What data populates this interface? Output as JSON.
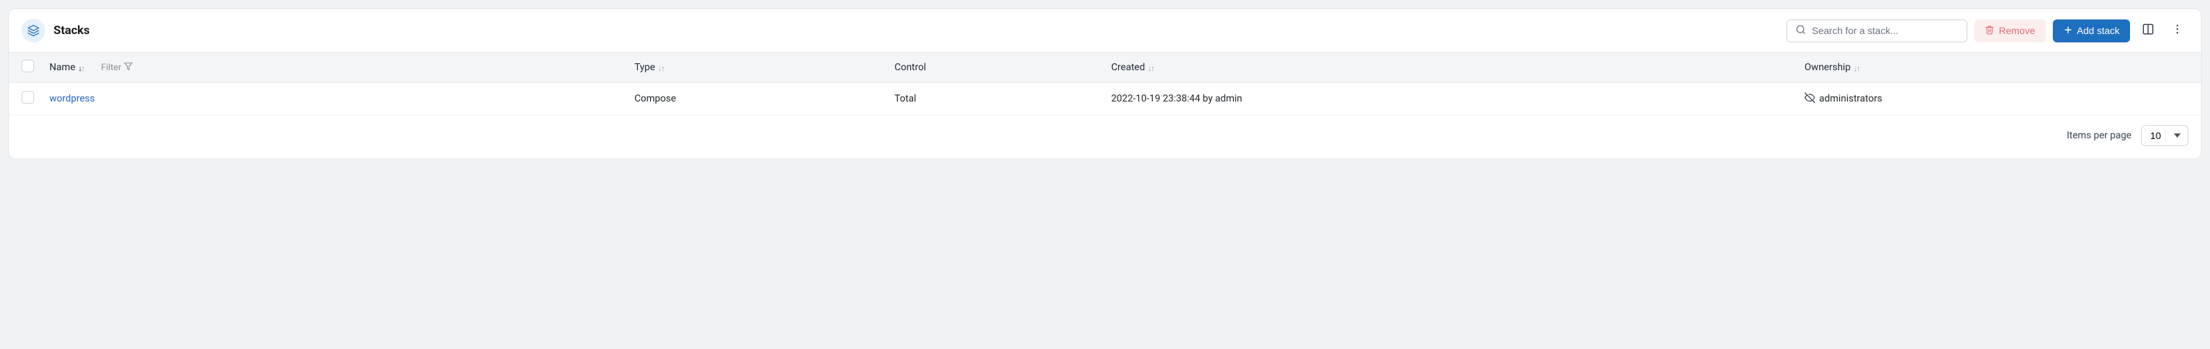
{
  "header": {
    "title": "Stacks",
    "search_placeholder": "Search for a stack...",
    "remove_label": "Remove",
    "add_label": "Add stack"
  },
  "columns": {
    "name": "Name",
    "filter": "Filter",
    "type": "Type",
    "control": "Control",
    "created": "Created",
    "ownership": "Ownership"
  },
  "rows": [
    {
      "name": "wordpress",
      "type": "Compose",
      "control": "Total",
      "created": "2022-10-19 23:38:44 by admin",
      "ownership": "administrators"
    }
  ],
  "footer": {
    "items_label": "Items per page",
    "page_size": "10"
  }
}
